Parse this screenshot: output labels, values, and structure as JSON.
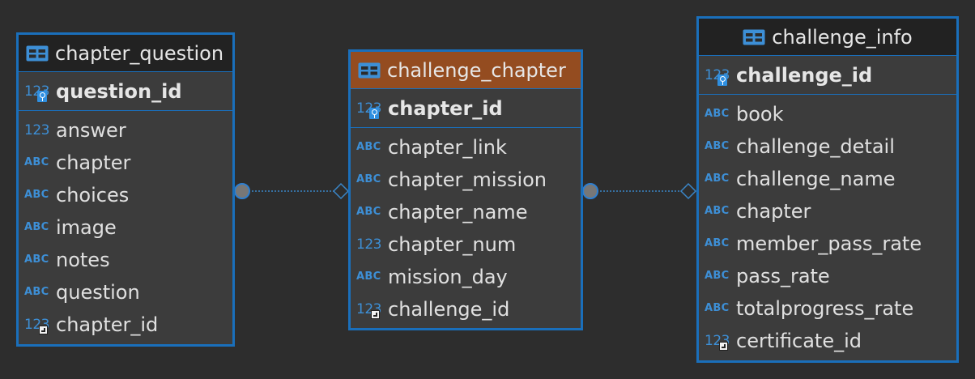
{
  "diagram": {
    "entities": [
      {
        "name": "chapter_question",
        "header_style": "dark",
        "primary_key": {
          "name": "question_id",
          "type": "123",
          "key": true
        },
        "columns": [
          {
            "name": "answer",
            "type": "123"
          },
          {
            "name": "chapter",
            "type": "ABC"
          },
          {
            "name": "choices",
            "type": "ABC"
          },
          {
            "name": "image",
            "type": "ABC"
          },
          {
            "name": "notes",
            "type": "ABC"
          },
          {
            "name": "question",
            "type": "ABC"
          },
          {
            "name": "chapter_id",
            "type": "123",
            "foreign_key": true
          }
        ]
      },
      {
        "name": "challenge_chapter",
        "header_style": "brown",
        "primary_key": {
          "name": "chapter_id",
          "type": "123",
          "key": true
        },
        "columns": [
          {
            "name": "chapter_link",
            "type": "ABC"
          },
          {
            "name": "chapter_mission",
            "type": "ABC"
          },
          {
            "name": "chapter_name",
            "type": "ABC"
          },
          {
            "name": "chapter_num",
            "type": "123"
          },
          {
            "name": "mission_day",
            "type": "ABC"
          },
          {
            "name": "challenge_id",
            "type": "123",
            "foreign_key": true
          }
        ]
      },
      {
        "name": "challenge_info",
        "header_style": "dark",
        "primary_key": {
          "name": "challenge_id",
          "type": "123",
          "key": true
        },
        "columns": [
          {
            "name": "book",
            "type": "ABC"
          },
          {
            "name": "challenge_detail",
            "type": "ABC"
          },
          {
            "name": "challenge_name",
            "type": "ABC"
          },
          {
            "name": "chapter",
            "type": "ABC"
          },
          {
            "name": "member_pass_rate",
            "type": "ABC"
          },
          {
            "name": "pass_rate",
            "type": "ABC"
          },
          {
            "name": "totalprogress_rate",
            "type": "ABC"
          },
          {
            "name": "certificate_id",
            "type": "123",
            "foreign_key": true
          }
        ]
      }
    ],
    "relationships": [
      {
        "from": "chapter_question",
        "to": "challenge_chapter"
      },
      {
        "from": "challenge_chapter",
        "to": "challenge_info"
      }
    ],
    "colors": {
      "background": "#2d2d2d",
      "entity_body": "#3c3c3c",
      "border": "#1a6fbb",
      "header_dark": "#222222",
      "header_selected": "#944c20",
      "type_icon": "#3d8fd6",
      "connector": "#3a86c8"
    }
  }
}
